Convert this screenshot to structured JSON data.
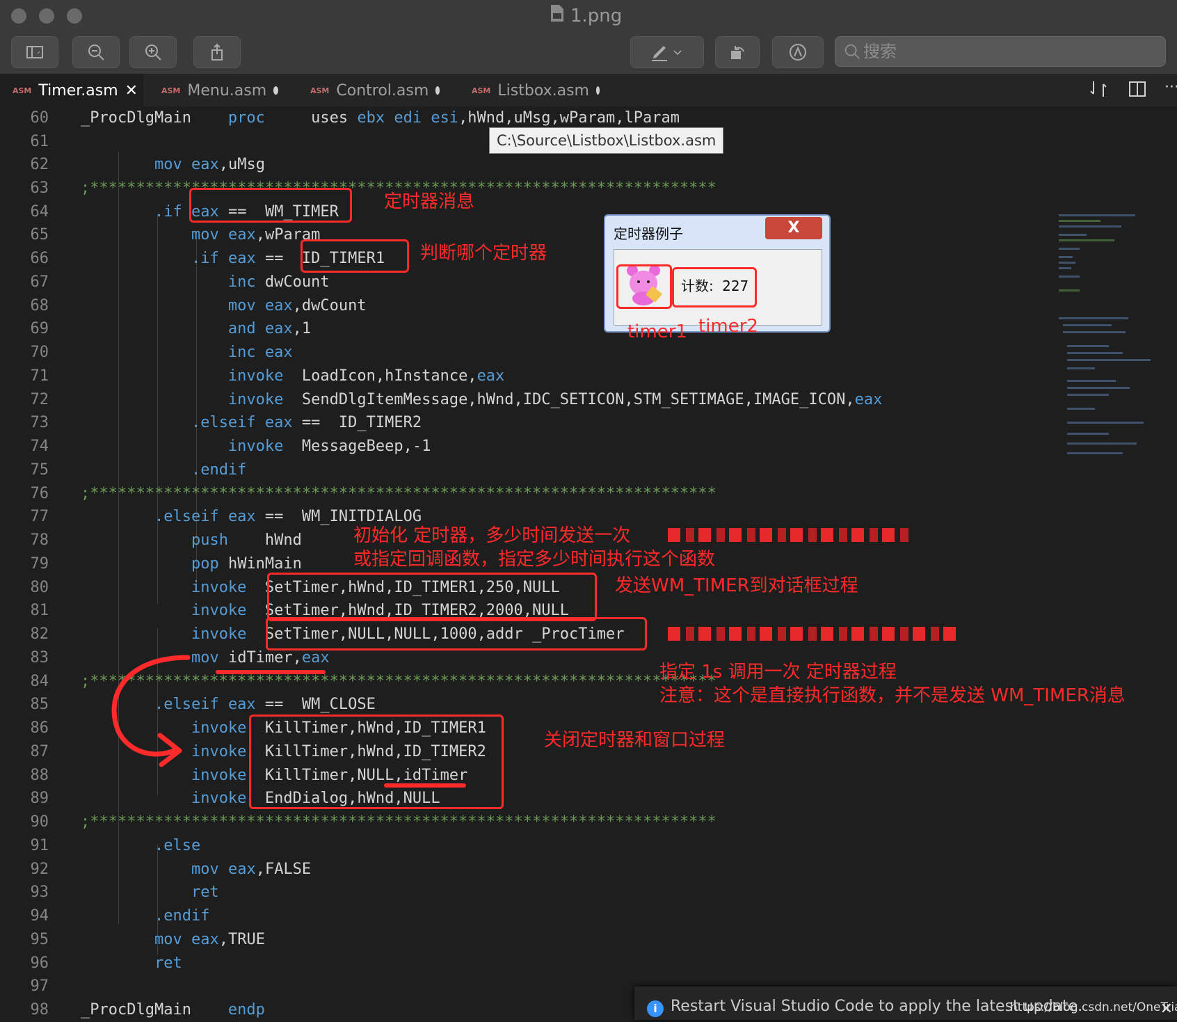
{
  "window": {
    "title": "1.png",
    "search_placeholder": "搜索"
  },
  "tabs": [
    {
      "label": "Timer.asm",
      "badge": "ASM",
      "state": "close"
    },
    {
      "label": "Menu.asm",
      "badge": "ASM",
      "state": "modified"
    },
    {
      "label": "Control.asm",
      "badge": "ASM",
      "state": "modified"
    },
    {
      "label": "Listbox.asm",
      "badge": "ASM",
      "state": "modified"
    }
  ],
  "tooltip": "C:\\Source\\Listbox\\Listbox.asm",
  "code": [
    {
      "n": "60"
    },
    {
      "n": "61"
    },
    {
      "n": "62"
    },
    {
      "n": "63"
    },
    {
      "n": "64"
    },
    {
      "n": "65"
    },
    {
      "n": "66"
    },
    {
      "n": "67"
    },
    {
      "n": "68"
    },
    {
      "n": "69"
    },
    {
      "n": "70"
    },
    {
      "n": "71"
    },
    {
      "n": "72"
    },
    {
      "n": "73"
    },
    {
      "n": "74"
    },
    {
      "n": "75"
    },
    {
      "n": "76"
    },
    {
      "n": "77"
    },
    {
      "n": "78"
    },
    {
      "n": "79"
    },
    {
      "n": "80"
    },
    {
      "n": "81"
    },
    {
      "n": "82"
    },
    {
      "n": "83"
    },
    {
      "n": "84"
    },
    {
      "n": "85"
    },
    {
      "n": "86"
    },
    {
      "n": "87"
    },
    {
      "n": "88"
    },
    {
      "n": "89"
    },
    {
      "n": "90"
    },
    {
      "n": "91"
    },
    {
      "n": "92"
    },
    {
      "n": "93"
    },
    {
      "n": "94"
    },
    {
      "n": "95"
    },
    {
      "n": "96"
    },
    {
      "n": "97"
    },
    {
      "n": "98"
    }
  ],
  "annotations": {
    "a1": "定时器消息",
    "a2": "判断哪个定时器",
    "a3": "初始化 定时器，多少时间发送一次",
    "a4": "或指定回调函数，指定多少时间执行这个函数",
    "a5": "发送WM_TIMER到对话框过程",
    "a6": "指定 1s 调用一次 定时器过程",
    "a7": "注意：这个是直接执行函数，并不是发送 WM_TIMER消息",
    "a8": "关闭定时器和窗口过程",
    "timer1": "timer1",
    "timer2": "timer2"
  },
  "dialog": {
    "title": "定时器例子",
    "close": "X",
    "count_label": "计数:",
    "count_value": "227"
  },
  "notification": {
    "text": "Restart Visual Studio Code to apply the latest update.",
    "watermark": "https://blog.csdn.net/OneTrianee"
  }
}
